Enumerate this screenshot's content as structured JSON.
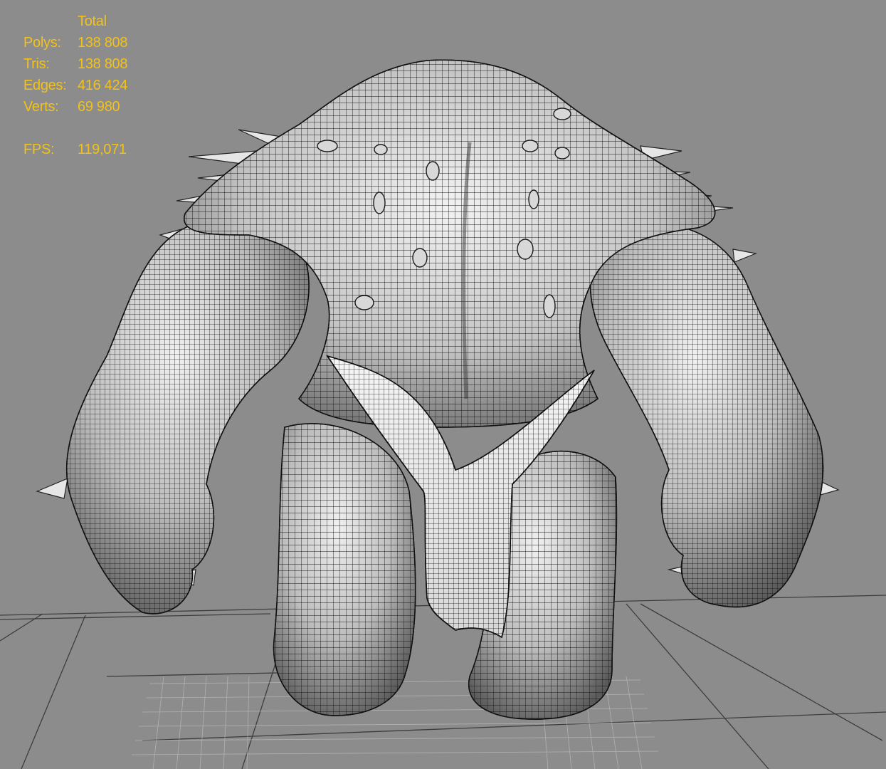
{
  "stats": {
    "header": "Total",
    "rows": [
      {
        "label": "Polys:",
        "value": "138 808"
      },
      {
        "label": "Tris:",
        "value": "138 808"
      },
      {
        "label": "Edges:",
        "value": "416 424"
      },
      {
        "label": "Verts:",
        "value": "69 980"
      }
    ],
    "fps_label": "FPS:",
    "fps_value": "119,071"
  },
  "colors": {
    "background": "#8c8c8c",
    "stats_text": "#f2c21a",
    "grid_line": "#3a3a3a",
    "wire": "#1a1a1a",
    "shade_light": "#e8e8e8",
    "shade_dark": "#555555"
  },
  "viewport_content": {
    "object": "wireframe-troll-mesh",
    "floor_grid": "home-grid"
  }
}
